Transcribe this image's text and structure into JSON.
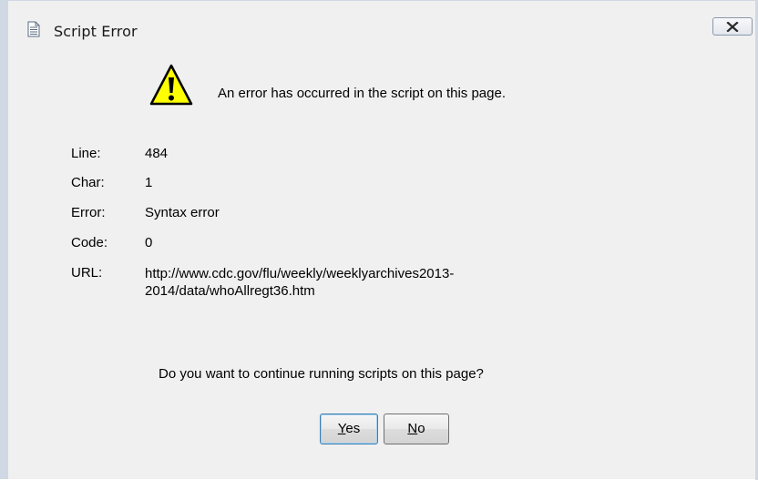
{
  "window": {
    "title": "Script Error"
  },
  "message": "An error has occurred in the script on this page.",
  "details": {
    "line_label": "Line:",
    "line_value": "484",
    "char_label": "Char:",
    "char_value": "1",
    "error_label": "Error:",
    "error_value": "Syntax error",
    "code_label": "Code:",
    "code_value": "0",
    "url_label": "URL:",
    "url_value_line1": "http://www.cdc.gov/flu/weekly/weeklyarchives2013-",
    "url_value_line2": "2014/data/whoAllregt36.htm"
  },
  "question": "Do you want to continue running scripts on this page?",
  "buttons": {
    "yes_mnemonic": "Y",
    "yes_rest": "es",
    "no_mnemonic": "N",
    "no_rest": "o"
  },
  "icons": {
    "title": "document-icon",
    "warning": "warning-icon",
    "close": "close-icon"
  },
  "colors": {
    "warning_fill": "#ffff00",
    "frame": "#cfd8e3",
    "dialog_bg": "#f0f0f0",
    "focus_border": "#3c7fb1"
  }
}
